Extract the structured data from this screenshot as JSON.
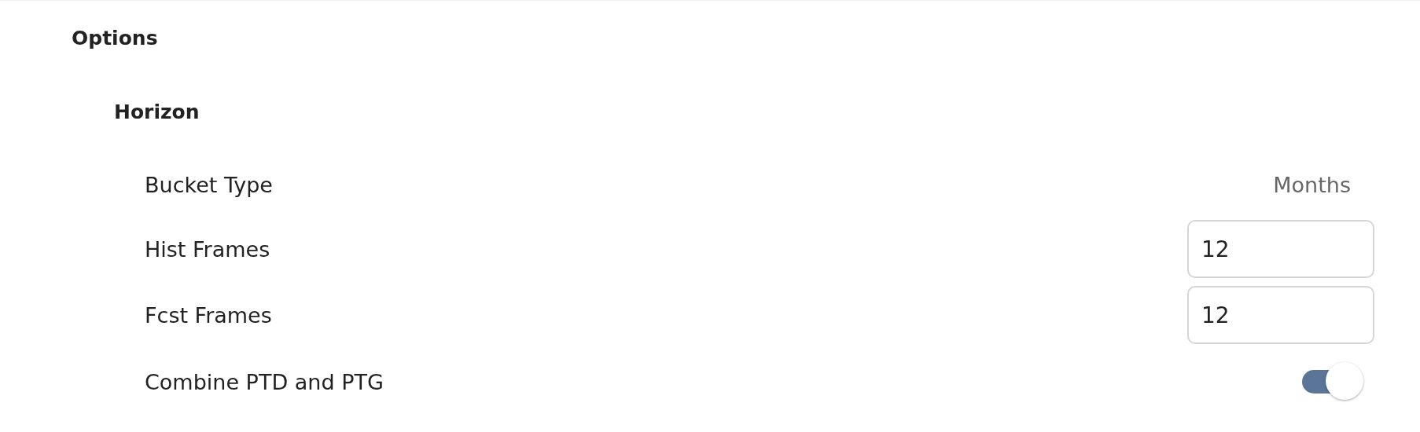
{
  "section": {
    "title": "Options"
  },
  "group": {
    "title": "Horizon"
  },
  "rows": [
    {
      "kind": "text",
      "label": "Bucket Type",
      "value": "Months"
    },
    {
      "kind": "input",
      "label": "Hist Frames",
      "value": "12"
    },
    {
      "kind": "input",
      "label": "Fcst Frames",
      "value": "12"
    },
    {
      "kind": "toggle",
      "label": "Combine PTD and PTG",
      "on": true
    }
  ]
}
